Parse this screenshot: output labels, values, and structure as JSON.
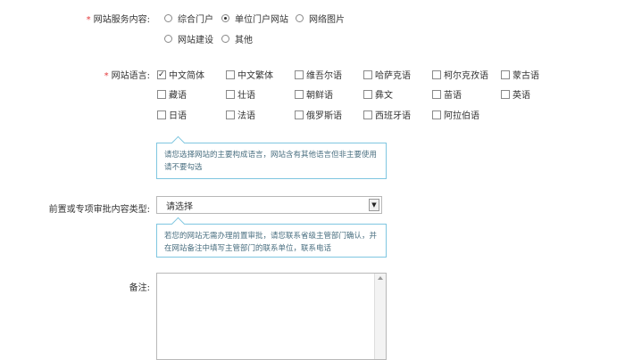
{
  "service": {
    "label": "网站服务内容:",
    "required_mark": "*",
    "options": [
      {
        "label": "综合门户",
        "selected": false
      },
      {
        "label": "单位门户网站",
        "selected": true
      },
      {
        "label": "网络图片",
        "selected": false
      },
      {
        "label": "网站建设",
        "selected": false
      },
      {
        "label": "其他",
        "selected": false
      }
    ]
  },
  "language": {
    "label": "网站语言:",
    "required_mark": "*",
    "options": [
      {
        "label": "中文简体",
        "checked": true
      },
      {
        "label": "中文繁体",
        "checked": false
      },
      {
        "label": "维吾尔语",
        "checked": false
      },
      {
        "label": "哈萨克语",
        "checked": false
      },
      {
        "label": "柯尔克孜语",
        "checked": false
      },
      {
        "label": "蒙古语",
        "checked": false
      },
      {
        "label": "藏语",
        "checked": false
      },
      {
        "label": "壮语",
        "checked": false
      },
      {
        "label": "朝鲜语",
        "checked": false
      },
      {
        "label": "彝文",
        "checked": false
      },
      {
        "label": "苗语",
        "checked": false
      },
      {
        "label": "英语",
        "checked": false
      },
      {
        "label": "日语",
        "checked": false
      },
      {
        "label": "法语",
        "checked": false
      },
      {
        "label": "俄罗斯语",
        "checked": false
      },
      {
        "label": "西班牙语",
        "checked": false
      },
      {
        "label": "阿拉伯语",
        "checked": false
      }
    ],
    "tip_line1": "请您选择网站的主要构成语言，网站含有其他语言但非主要使用",
    "tip_line2": "请不要勾选"
  },
  "approval": {
    "label": "前置或专项审批内容类型:",
    "select_value": "请选择",
    "tip_line1": "若您的网站无需办理前置审批，请您联系省级主管部门确认，并",
    "tip_line2": "在网站备注中填写主管部门的联系单位，联系电话"
  },
  "remark": {
    "label": "备注:",
    "value": ""
  }
}
